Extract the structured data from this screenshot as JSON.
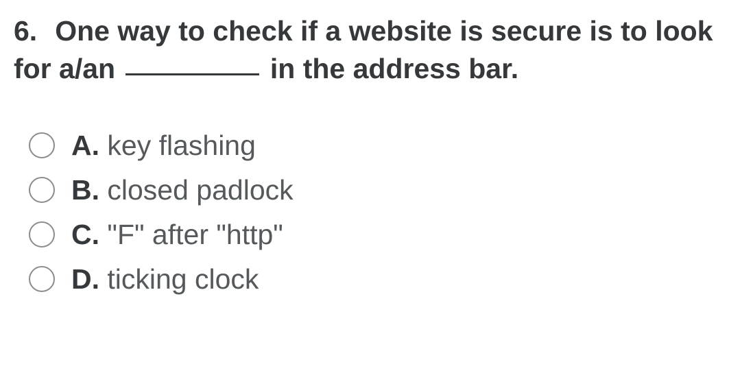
{
  "question": {
    "number": "6.",
    "text_part1": "One way to check if a website is secure is to look for a/an ",
    "text_part2": " in the address bar."
  },
  "options": [
    {
      "letter": "A.",
      "text": " key flashing"
    },
    {
      "letter": "B.",
      "text": " closed padlock"
    },
    {
      "letter": "C.",
      "text": " \"F\" after \"http\""
    },
    {
      "letter": "D.",
      "text": " ticking clock"
    }
  ]
}
